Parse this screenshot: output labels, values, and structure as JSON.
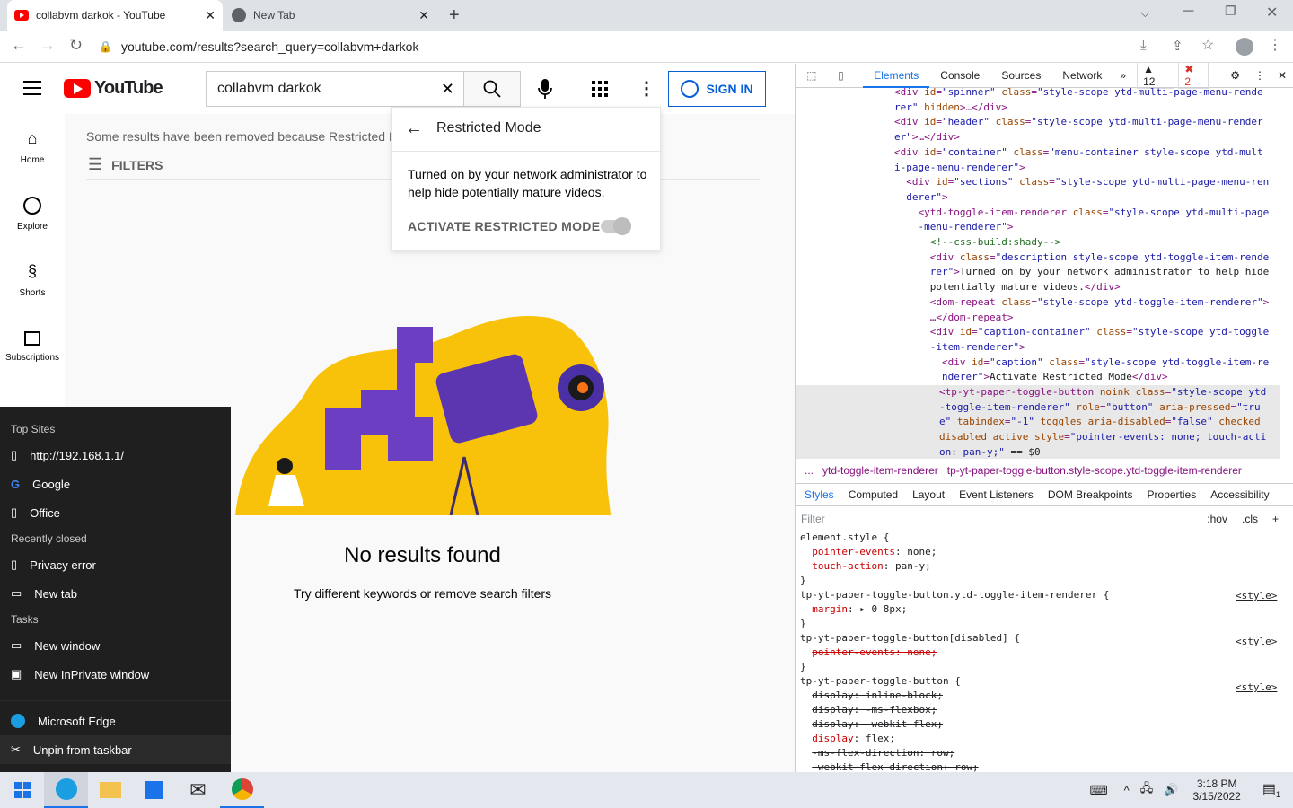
{
  "browser": {
    "tabs": [
      {
        "title": "collabvm darkok - YouTube"
      },
      {
        "title": "New Tab"
      }
    ],
    "url": "youtube.com/results?search_query=collabvm+darkok"
  },
  "youtube": {
    "logo_text": "YouTube",
    "search_value": "collabvm darkok",
    "signin_label": "SIGN IN",
    "guide": [
      {
        "label": "Home"
      },
      {
        "label": "Explore"
      },
      {
        "label": "Shorts"
      },
      {
        "label": "Subscriptions"
      }
    ],
    "restricted_notice": "Some results have been removed because Restricted M",
    "filters_label": "FILTERS",
    "no_results_title": "No results found",
    "no_results_subtitle": "Try different keywords or remove search filters",
    "restricted_popup": {
      "title": "Restricted Mode",
      "description": "Turned on by your network administrator to help hide potentially mature videos.",
      "toggle_label": "ACTIVATE RESTRICTED MODE"
    }
  },
  "devtools": {
    "tabs": [
      "Elements",
      "Console",
      "Sources",
      "Network"
    ],
    "warnings": "12",
    "errors": "2",
    "breadcrumb": [
      "...",
      "ytd-toggle-item-renderer",
      "tp-yt-paper-toggle-button.style-scope.ytd-toggle-item-renderer"
    ],
    "subtabs": [
      "Styles",
      "Computed",
      "Layout",
      "Event Listeners",
      "DOM Breakpoints",
      "Properties",
      "Accessibility"
    ],
    "filter_placeholder": "Filter",
    "hov": ":hov",
    "cls": ".cls",
    "style_source": "<style>"
  },
  "jumplist": {
    "top_sites_header": "Top Sites",
    "top_sites": [
      "http://192.168.1.1/",
      "Google",
      "Office"
    ],
    "recent_header": "Recently closed",
    "recent": [
      "Privacy error",
      "New tab"
    ],
    "tasks_header": "Tasks",
    "tasks": [
      "New window",
      "New InPrivate window"
    ],
    "app_name": "Microsoft Edge",
    "unpin": "Unpin from taskbar"
  },
  "taskbar": {
    "time": "3:18 PM",
    "date": "3/15/2022",
    "notification_count": "1"
  }
}
